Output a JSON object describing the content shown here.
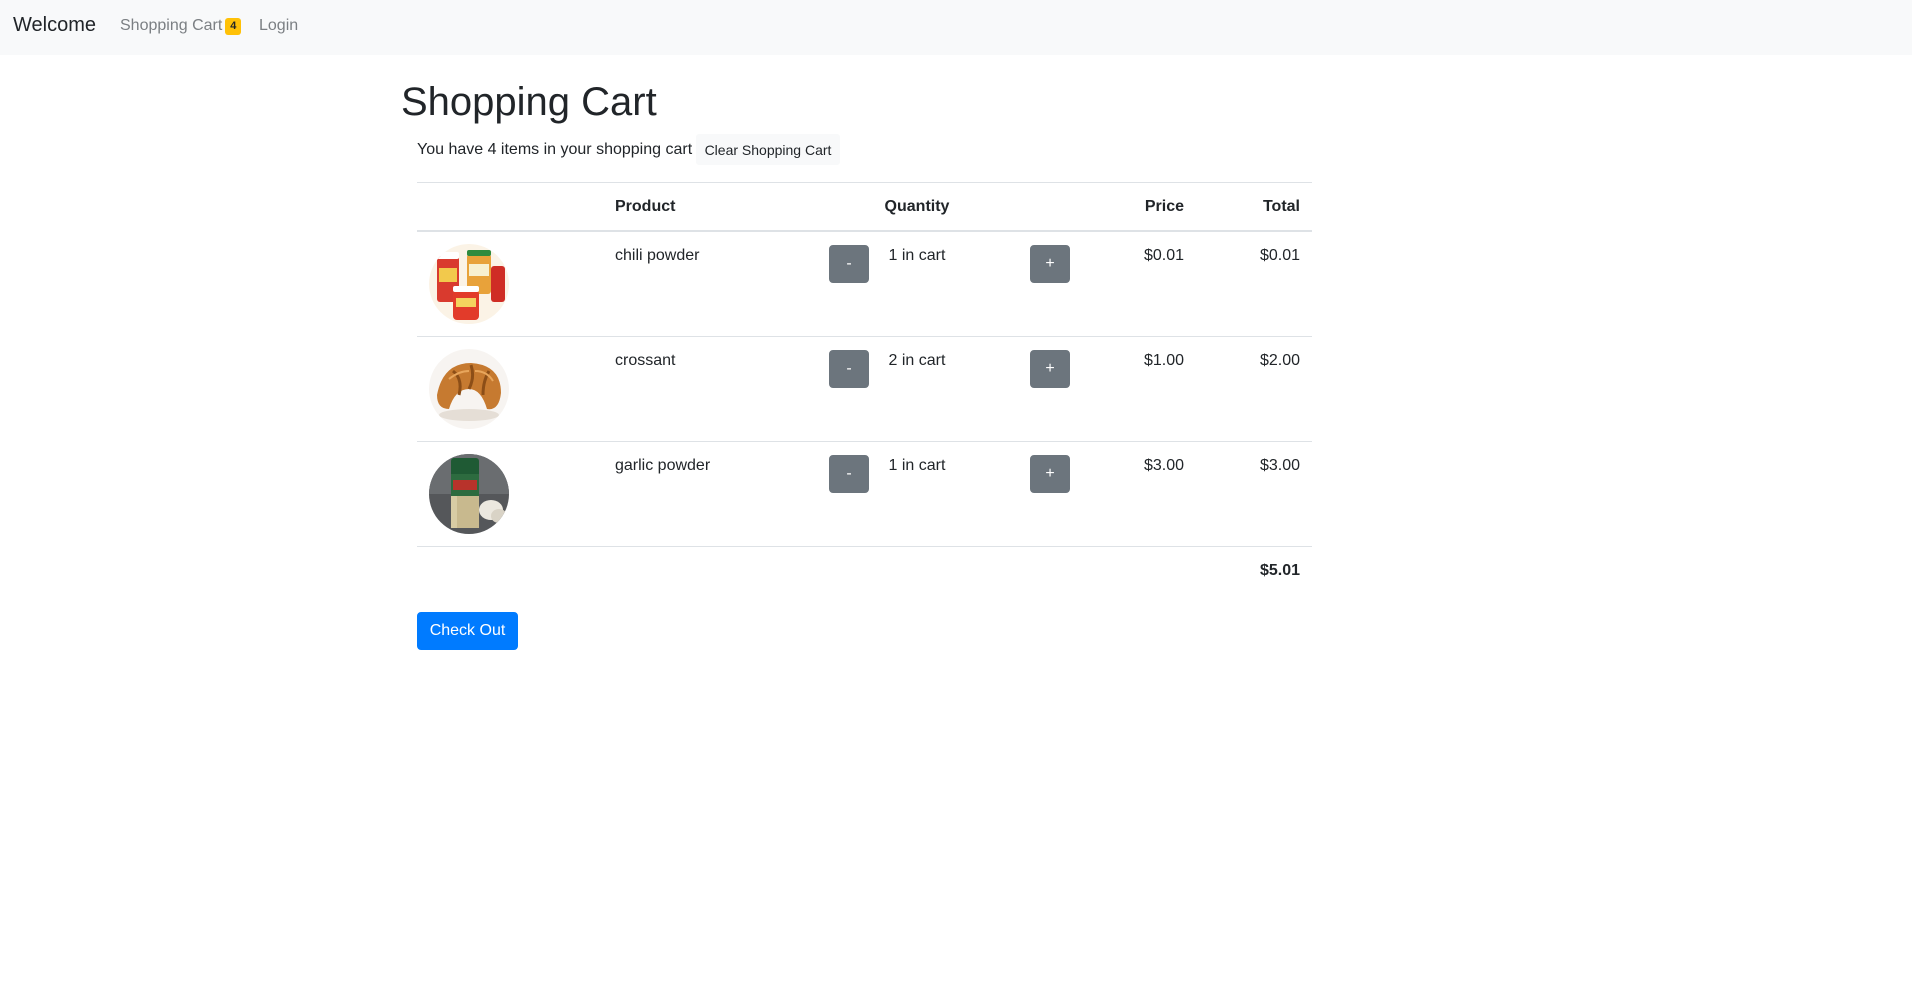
{
  "navbar": {
    "brand": "Welcome",
    "cart_label": "Shopping Cart",
    "cart_count": "4",
    "login_label": "Login"
  },
  "page": {
    "title": "Shopping Cart",
    "summary": "You have 4 items in your shopping cart",
    "clear_label": "Clear Shopping Cart"
  },
  "table": {
    "headers": {
      "product": "Product",
      "quantity": "Quantity",
      "price": "Price",
      "total": "Total"
    },
    "items": [
      {
        "name": "chili powder",
        "image": "chili-powder-image",
        "minus": "-",
        "quantity": "1 in cart",
        "plus": "+",
        "price": "$0.01",
        "total": "$0.01"
      },
      {
        "name": "crossant",
        "image": "croissant-image",
        "minus": "-",
        "quantity": "2 in cart",
        "plus": "+",
        "price": "$1.00",
        "total": "$2.00"
      },
      {
        "name": "garlic powder",
        "image": "garlic-powder-image",
        "minus": "-",
        "quantity": "1 in cart",
        "plus": "+",
        "price": "$3.00",
        "total": "$3.00"
      }
    ],
    "grand_total": "$5.01"
  },
  "checkout_label": "Check Out",
  "colors": {
    "navbar_bg": "#f8f9fa",
    "badge": "#ffc107",
    "secondary_button": "#6c757d",
    "primary_button": "#007bff"
  }
}
